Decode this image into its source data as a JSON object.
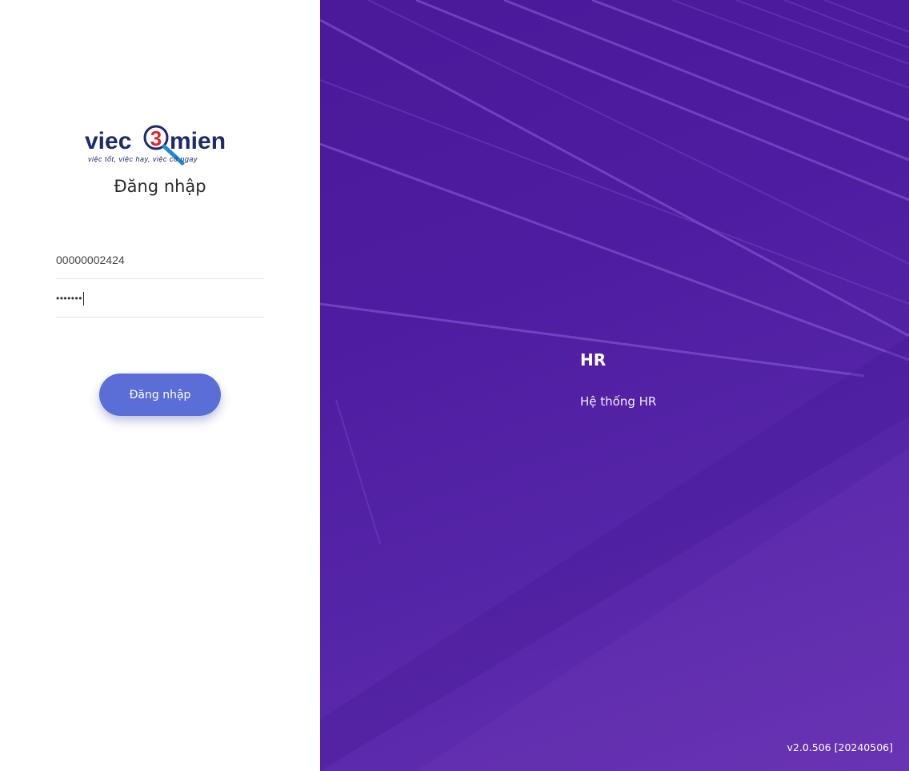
{
  "brand": {
    "logo_left": "viec",
    "logo_number": "3",
    "logo_right": "mien",
    "tagline": "việc tốt, việc hay, việc có ngay"
  },
  "login": {
    "title": "Đăng nhập",
    "username_value": "00000002424",
    "password_value": "•••••••",
    "submit_label": "Đăng nhập"
  },
  "hero": {
    "title": "HR",
    "subtitle": "Hệ thống HR"
  },
  "footer": {
    "version": "v2.0.506 [20240506]"
  },
  "colors": {
    "brand_navy": "#1b2a6b",
    "brand_red": "#e0262b",
    "button": "#5b6ed8",
    "panel_purple": "#4e1ca0"
  }
}
